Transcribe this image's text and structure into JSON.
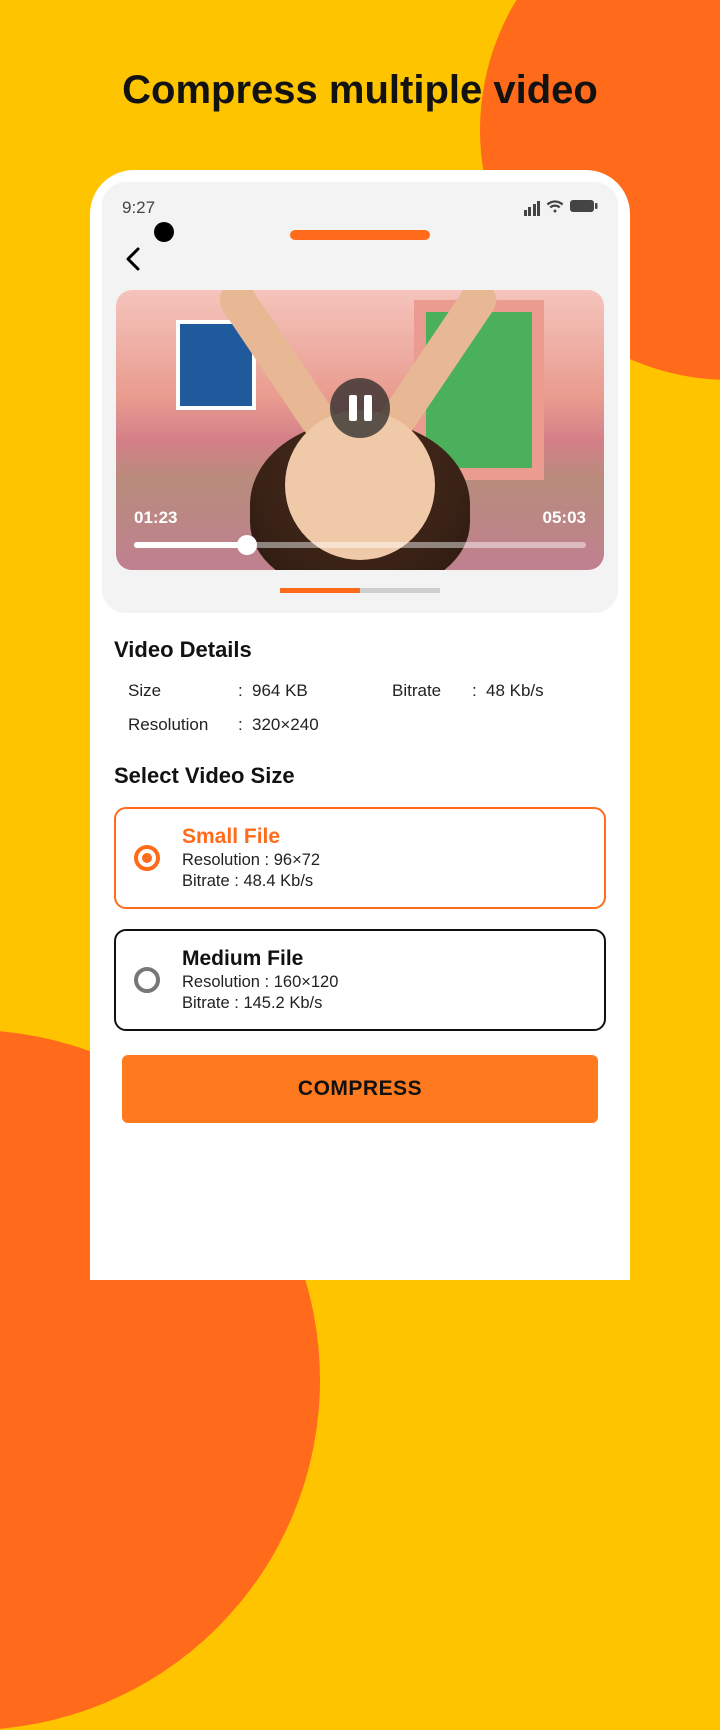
{
  "headline": "Compress multiple video",
  "status": {
    "time": "9:27"
  },
  "player": {
    "current": "01:23",
    "total": "05:03",
    "progress_pct": 25
  },
  "details": {
    "title": "Video Details",
    "size_label": "Size",
    "size_value": "964 KB",
    "bitrate_label": "Bitrate",
    "bitrate_value": "48 Kb/s",
    "resolution_label": "Resolution",
    "resolution_value": "320×240"
  },
  "select_title": "Select Video Size",
  "options": [
    {
      "title": "Small File",
      "resolution": "Resolution : 96×72",
      "bitrate": "Bitrate : 48.4 Kb/s",
      "selected": true
    },
    {
      "title": "Medium File",
      "resolution": "Resolution : 160×120",
      "bitrate": "Bitrate : 145.2 Kb/s",
      "selected": false
    }
  ],
  "cta": "COMPRESS"
}
